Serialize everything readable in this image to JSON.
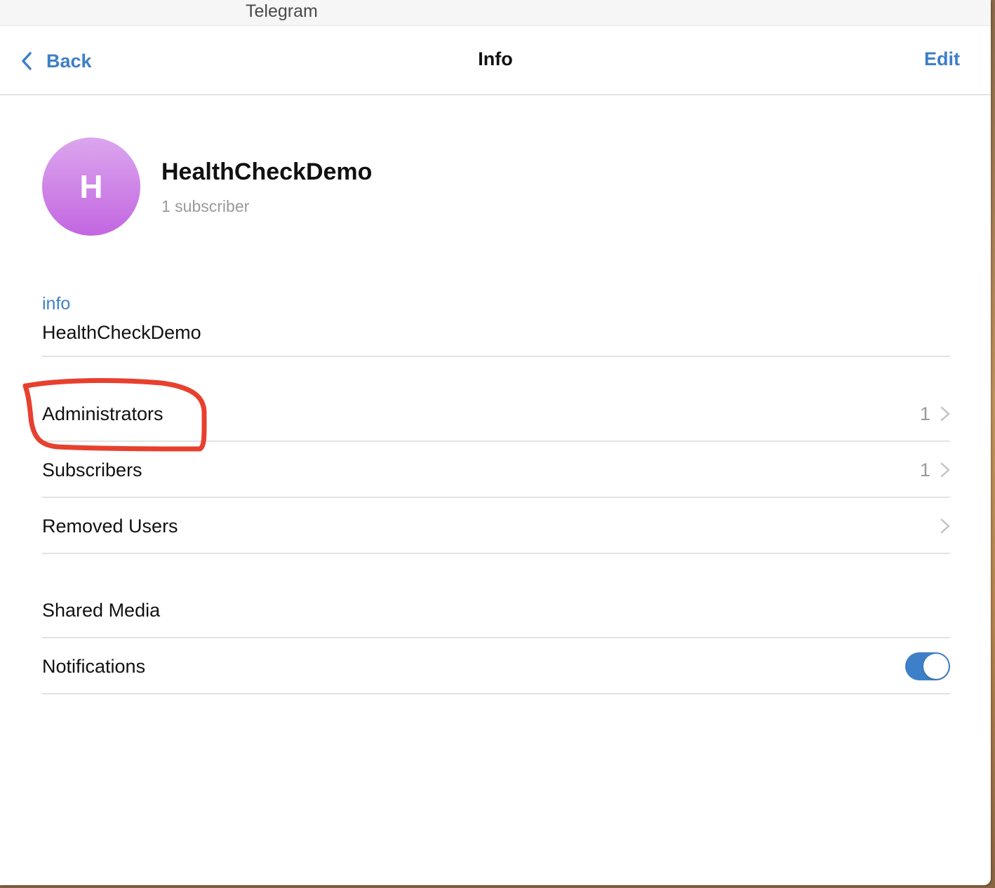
{
  "window": {
    "title": "Telegram"
  },
  "navbar": {
    "back_label": "Back",
    "title": "Info",
    "edit_label": "Edit"
  },
  "channel": {
    "avatar_letter": "H",
    "avatar_colors": [
      "#dca6ee",
      "#c266e0"
    ],
    "name": "HealthCheckDemo",
    "subscriber_count": "1 subscriber"
  },
  "info": {
    "label": "info",
    "value": "HealthCheckDemo"
  },
  "rows": {
    "administrators": {
      "label": "Administrators",
      "count": "1"
    },
    "subscribers": {
      "label": "Subscribers",
      "count": "1"
    },
    "removed_users": {
      "label": "Removed Users"
    },
    "shared_media": {
      "label": "Shared Media"
    },
    "notifications": {
      "label": "Notifications",
      "enabled": true
    }
  },
  "colors": {
    "accent": "#3d7fc8",
    "annotation": "#e8402e"
  },
  "icons": [
    "chevron-left-icon",
    "chevron-right-icon"
  ]
}
